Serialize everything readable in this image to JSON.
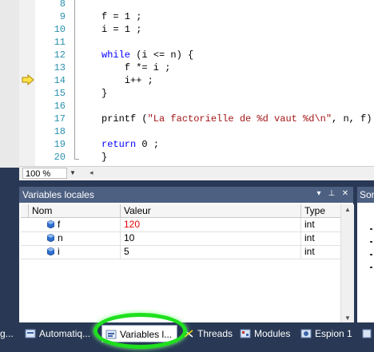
{
  "editor": {
    "lines": [
      {
        "num": "8",
        "text": ""
      },
      {
        "num": "9",
        "text": "f = 1 ;"
      },
      {
        "num": "10",
        "text": "i = 1 ;"
      },
      {
        "num": "11",
        "text": ""
      },
      {
        "num": "12",
        "kw": "while",
        "text": " (i <= n) {"
      },
      {
        "num": "13",
        "text": "    f *= i ;"
      },
      {
        "num": "14",
        "text": "    i++ ;"
      },
      {
        "num": "15",
        "text": "}"
      },
      {
        "num": "16",
        "text": ""
      },
      {
        "num": "17",
        "pre": "printf (",
        "str": "\"La factorielle de %d vaut %d\\n\"",
        "post": ", n, f) ;"
      },
      {
        "num": "18",
        "text": ""
      },
      {
        "num": "19",
        "kw": "return",
        "text": " 0 ;"
      },
      {
        "num": "20",
        "text": "}"
      }
    ],
    "current_line": "14",
    "zoom": "100 %"
  },
  "locals": {
    "title": "Variables locales",
    "columns": [
      "Nom",
      "Valeur",
      "Type"
    ],
    "rows": [
      {
        "name": "f",
        "value": "120",
        "type": "int",
        "changed": true
      },
      {
        "name": "n",
        "value": "10",
        "type": "int",
        "changed": false
      },
      {
        "name": "i",
        "value": "5",
        "type": "int",
        "changed": false
      }
    ],
    "buttons": {
      "dropdown": "▾",
      "pin": "⊥",
      "close": "✕"
    }
  },
  "right_panel": {
    "title": "Sor"
  },
  "tabs": {
    "partial_left": "g...",
    "automatic": "Automatiq...",
    "locals": "Variables l...",
    "threads": "Threads",
    "modules": "Modules",
    "watch": "Espion 1"
  },
  "colors": {
    "panel_title_bg": "#4d6082",
    "tabbar_bg": "#293955",
    "changed_value": "#e00000",
    "highlight": "#1ee01e"
  }
}
